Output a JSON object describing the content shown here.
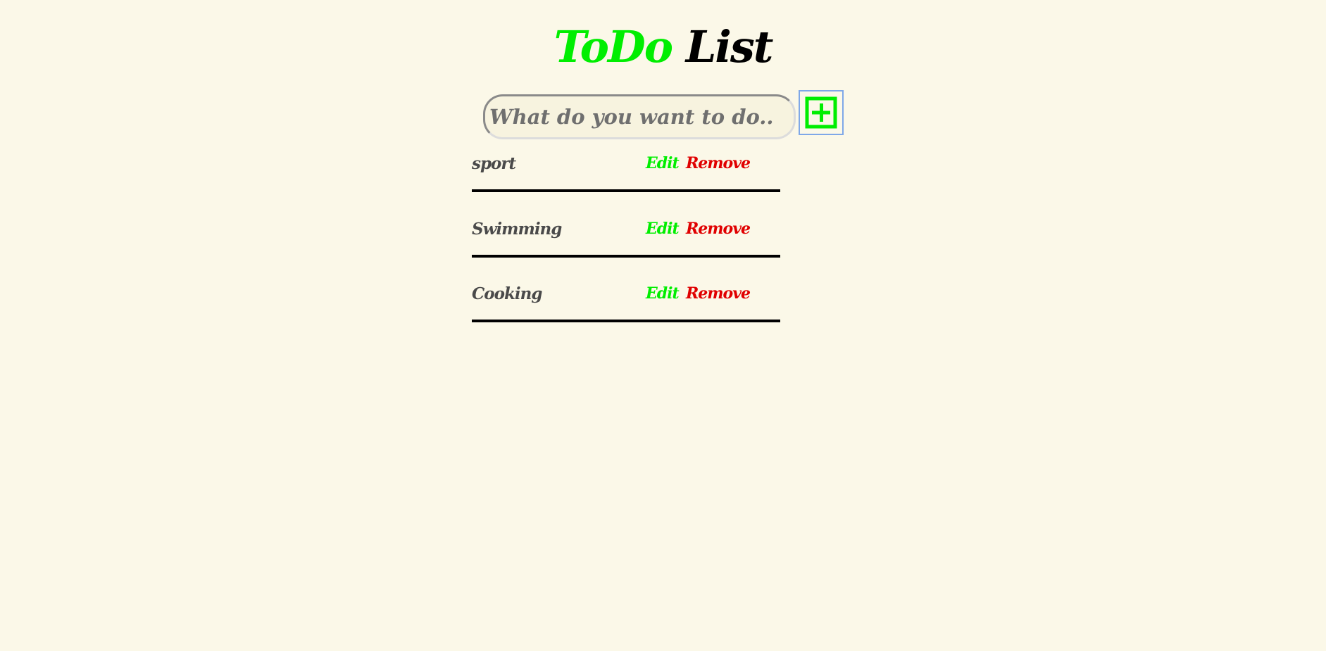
{
  "header": {
    "title_accent": "ToDo",
    "title_rest": "List"
  },
  "input": {
    "placeholder": "What do you want to do..",
    "value": ""
  },
  "add_button": {
    "icon": "plus-square-icon"
  },
  "todos": [
    {
      "text": "sport",
      "edit_label": "Edit",
      "remove_label": "Remove"
    },
    {
      "text": "Swimming",
      "edit_label": "Edit",
      "remove_label": "Remove"
    },
    {
      "text": "Cooking",
      "edit_label": "Edit",
      "remove_label": "Remove"
    }
  ],
  "colors": {
    "background": "#fbf8e8",
    "accent_green": "#00ee00",
    "remove_red": "#e00000",
    "text_dark": "#4a4a4a",
    "divider": "#000000"
  }
}
